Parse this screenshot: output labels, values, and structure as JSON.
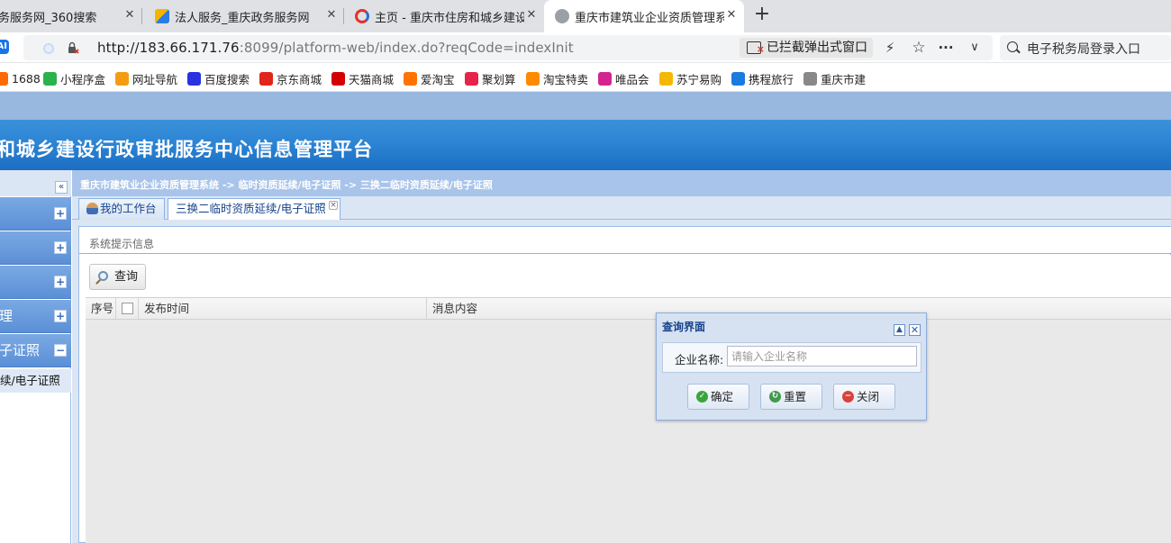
{
  "browser": {
    "tabs": [
      {
        "title": "务服务网_360搜索"
      },
      {
        "title": "法人服务_重庆政务服务网"
      },
      {
        "title": "主页 - 重庆市住房和城乡建设"
      },
      {
        "title": "重庆市建筑业企业资质管理系"
      }
    ],
    "new_tab_label": "+",
    "url": {
      "host": "http://183.66.171.76",
      "path": ":8099/platform-web/index.do?reqCode=indexInit"
    },
    "popup_blocked": "已拦截弹出式窗口",
    "search_text": "电子税务局登录入口",
    "bookmarks": [
      {
        "label": "1688",
        "icon": "1688-icon",
        "color": "#ff6a00"
      },
      {
        "label": "小程序盒",
        "icon": "mini-program-icon",
        "color": "#2bb24c"
      },
      {
        "label": "网址导航",
        "icon": "nav-icon",
        "color": "#f39c12"
      },
      {
        "label": "百度搜索",
        "icon": "baidu-icon",
        "color": "#2932e1"
      },
      {
        "label": "京东商城",
        "icon": "jd-icon",
        "color": "#e1251b"
      },
      {
        "label": "天猫商城",
        "icon": "tmall-icon",
        "color": "#d40000"
      },
      {
        "label": "爱淘宝",
        "icon": "aitaobao-icon",
        "color": "#ff7300"
      },
      {
        "label": "聚划算",
        "icon": "juhuasuan-icon",
        "color": "#e62449"
      },
      {
        "label": "淘宝特卖",
        "icon": "taobao-sale-icon",
        "color": "#ff8a00"
      },
      {
        "label": "唯品会",
        "icon": "vip-icon",
        "color": "#d3258f"
      },
      {
        "label": "苏宁易购",
        "icon": "suning-icon",
        "color": "#f5b800"
      },
      {
        "label": "携程旅行",
        "icon": "ctrip-icon",
        "color": "#1a7ae0"
      },
      {
        "label": "重庆市建",
        "icon": "globe-icon",
        "color": "#888888"
      }
    ]
  },
  "app": {
    "title": "和城乡建设行政审批服务中心信息管理平台",
    "breadcrumb": "重庆市建筑业企业资质管理系统 -> 临时资质延续/电子证照 -> 三换二临时资质延续/电子证照",
    "nav": {
      "collapse_label": "«",
      "items": [
        {
          "label": "",
          "toggle": "+"
        },
        {
          "label": "",
          "toggle": "+"
        },
        {
          "label": "",
          "toggle": "+"
        },
        {
          "label": "理",
          "toggle": "+"
        },
        {
          "label": "子证照",
          "toggle": "−"
        }
      ],
      "subitem": "续/电子证照"
    },
    "tabs": [
      {
        "label": "我的工作台"
      },
      {
        "label": "三换二临时资质延续/电子证照"
      }
    ],
    "panel_title": "系统提示信息",
    "query_button": "查询",
    "grid_columns": [
      "序号",
      "发布时间",
      "消息内容"
    ]
  },
  "dialog": {
    "title": "查询界面",
    "field_label": "企业名称:",
    "field_placeholder": "请输入企业名称",
    "field_value": "",
    "buttons": [
      {
        "label": "确定",
        "icon": "check-icon",
        "color": "#3aa53a"
      },
      {
        "label": "重置",
        "icon": "reset-icon",
        "color": "#3f9a4c"
      },
      {
        "label": "关闭",
        "icon": "close-icon",
        "color": "#d9413a"
      }
    ]
  }
}
